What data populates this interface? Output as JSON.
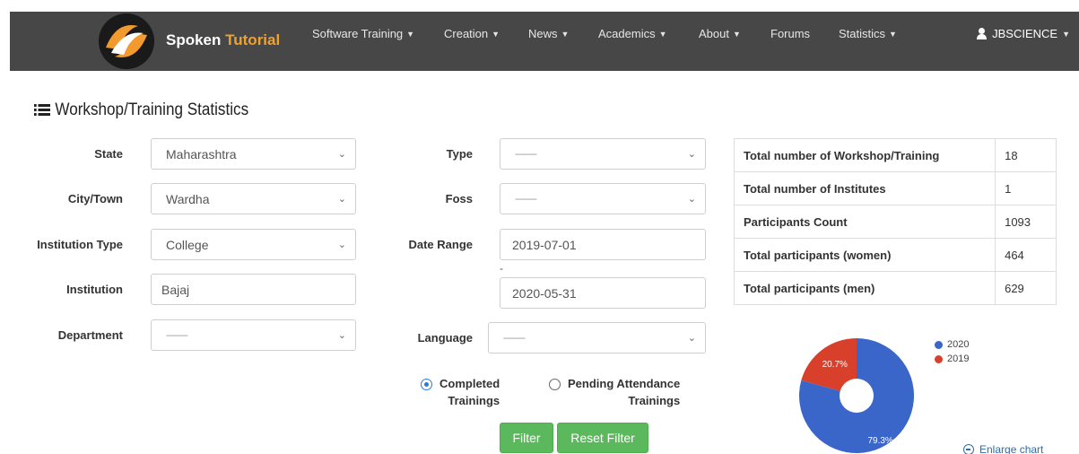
{
  "navbar": {
    "brand": {
      "first": "Spoken",
      "second": "Tutorial"
    },
    "items": [
      {
        "label": "Software Training"
      },
      {
        "label": "Creation"
      },
      {
        "label": "News"
      },
      {
        "label": "Academics"
      },
      {
        "label": "About"
      },
      {
        "label": "Forums"
      },
      {
        "label": "Statistics"
      }
    ],
    "user": "JBSCIENCE"
  },
  "page": {
    "title": "Workshop/Training Statistics"
  },
  "form": {
    "state": {
      "label": "State",
      "value": "Maharashtra"
    },
    "city": {
      "label": "City/Town",
      "value": "Wardha"
    },
    "institution_type": {
      "label": "Institution Type",
      "value": "College"
    },
    "institution": {
      "label": "Institution",
      "value": "Bajaj"
    },
    "department": {
      "label": "Department",
      "value": "---------"
    },
    "type": {
      "label": "Type",
      "value": "---------"
    },
    "foss": {
      "label": "Foss",
      "value": "---------"
    },
    "date_range": {
      "label": "Date Range",
      "from": "2019-07-01",
      "separator": "-",
      "to": "2020-05-31"
    },
    "language": {
      "label": "Language",
      "value": "---------"
    },
    "radio_completed": {
      "line1": "Completed",
      "line2": "Trainings",
      "selected": true
    },
    "radio_pending": {
      "line1": "Pending Attendance",
      "line2": "Trainings",
      "selected": false
    },
    "filter_button": "Filter",
    "reset_button": "Reset Filter"
  },
  "stats": [
    {
      "label": "Total number of Workshop/Training",
      "value": "18"
    },
    {
      "label": "Total number of Institutes",
      "value": "1"
    },
    {
      "label": "Participants Count",
      "value": "1093"
    },
    {
      "label": "Total participants (women)",
      "value": "464"
    },
    {
      "label": "Total participants (men)",
      "value": "629"
    }
  ],
  "chart_data": {
    "type": "pie",
    "categories": [
      "2020",
      "2019"
    ],
    "values": [
      79.3,
      20.7
    ],
    "labels": [
      "79.3%",
      "20.7%"
    ],
    "colors": [
      "#3a66c9",
      "#d9402b"
    ],
    "legend": "top-right",
    "enlarge_label": "Enlarge chart"
  },
  "colors": {
    "navbar": "#474747",
    "brand_accent": "#f0a22e",
    "button": "#5cb85c"
  }
}
